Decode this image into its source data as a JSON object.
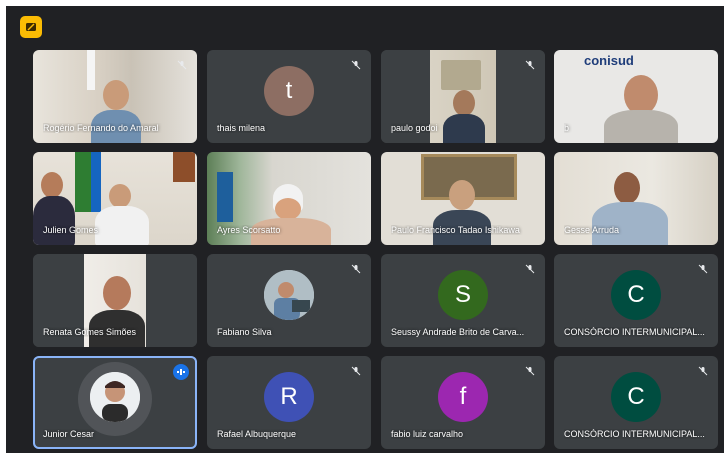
{
  "app": {
    "icon": "meet-app-icon",
    "color": "#fbbc04"
  },
  "participants": [
    {
      "name": "Rogério Fernando do Amaral",
      "muted": true,
      "kind": "video"
    },
    {
      "name": "thais milena",
      "muted": true,
      "kind": "letter",
      "initial": "t",
      "color": "#8d6e63"
    },
    {
      "name": "paulo godoi",
      "muted": true,
      "kind": "video"
    },
    {
      "name": "b",
      "muted": false,
      "kind": "video",
      "logo": "conisud"
    },
    {
      "name": "Julien Gomes",
      "muted": false,
      "kind": "video"
    },
    {
      "name": "Ayres Scorsatto",
      "muted": false,
      "kind": "video"
    },
    {
      "name": "Paulo Francisco Tadao Ishikawa",
      "muted": false,
      "kind": "video"
    },
    {
      "name": "Gesse Arruda",
      "muted": false,
      "kind": "video"
    },
    {
      "name": "Renata Gomes Simões",
      "muted": false,
      "kind": "video"
    },
    {
      "name": "Fabiano Silva",
      "muted": true,
      "kind": "photo"
    },
    {
      "name": "Seussy Andrade Brito de Carva...",
      "muted": true,
      "kind": "letter",
      "initial": "S",
      "color": "#33691e"
    },
    {
      "name": "CONSÓRCIO INTERMUNICIPAL...",
      "muted": true,
      "kind": "letter",
      "initial": "C",
      "color": "#004d40"
    },
    {
      "name": "Junior Cesar",
      "muted": false,
      "speaking": true,
      "kind": "photo"
    },
    {
      "name": "Rafael Albuquerque",
      "muted": true,
      "kind": "letter",
      "initial": "R",
      "color": "#3f51b5"
    },
    {
      "name": "fabio luiz carvalho",
      "muted": true,
      "kind": "letter",
      "initial": "f",
      "color": "#9c27b0"
    },
    {
      "name": "CONSÓRCIO INTERMUNICIPAL...",
      "muted": true,
      "kind": "letter",
      "initial": "C",
      "color": "#004d40"
    }
  ]
}
